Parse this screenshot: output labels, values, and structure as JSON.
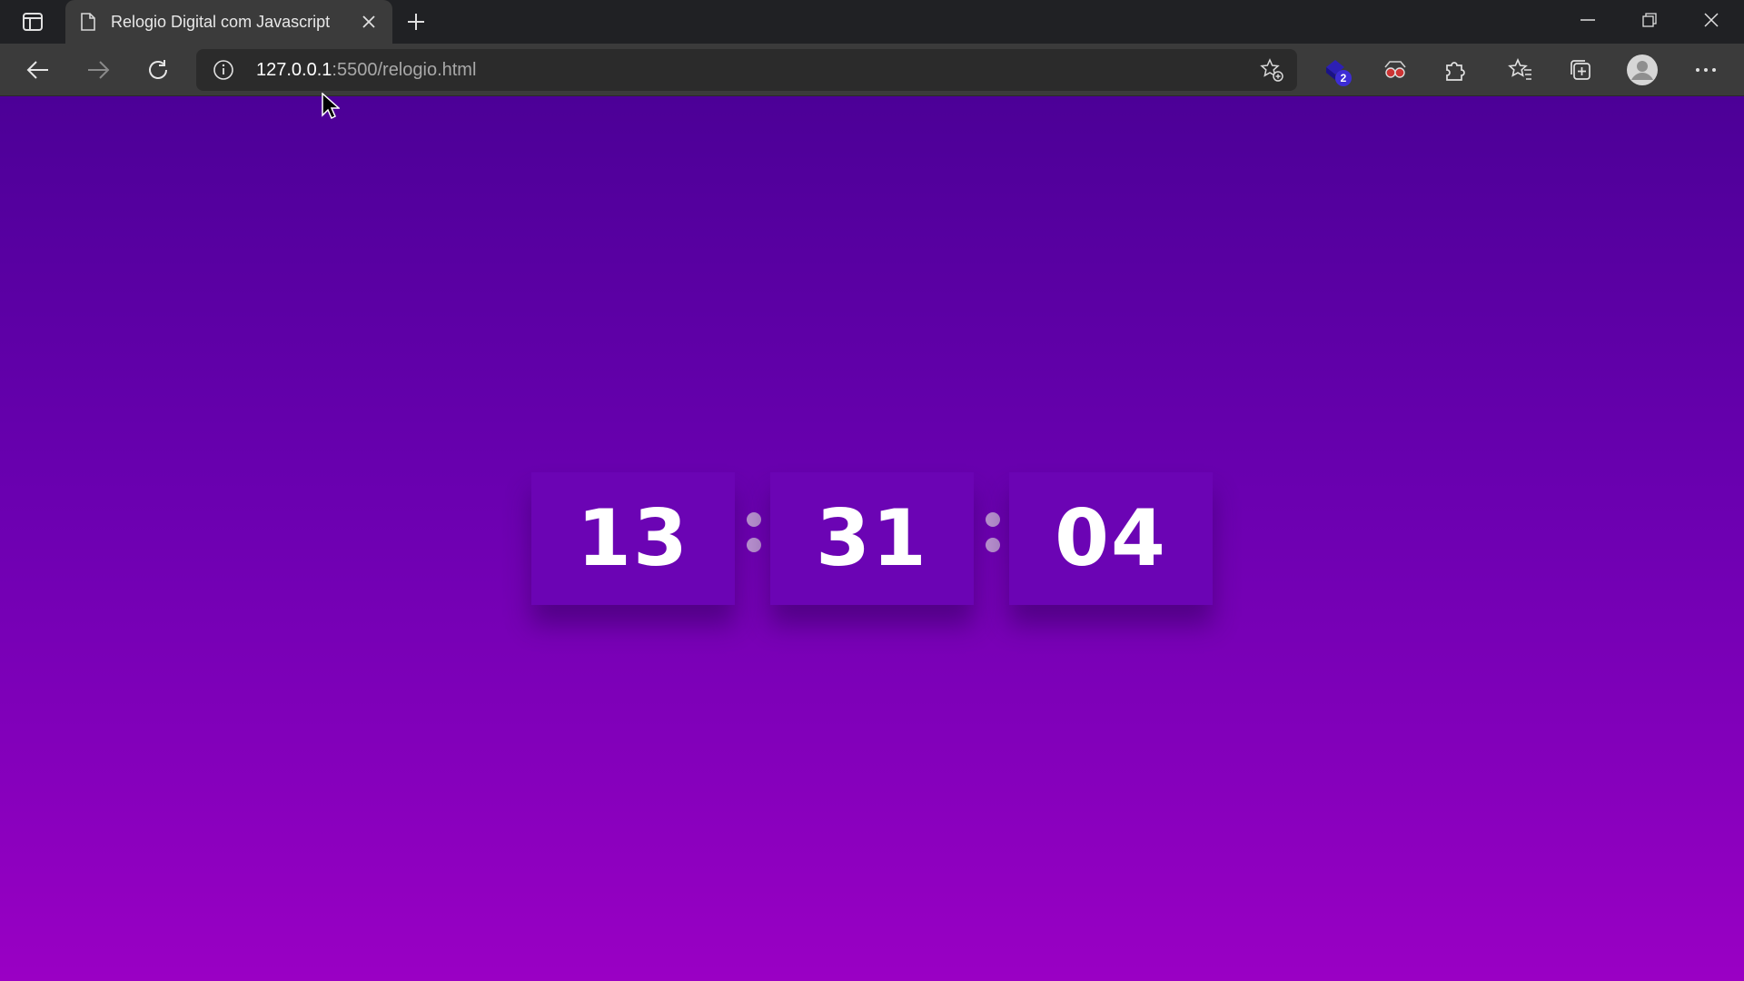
{
  "browser": {
    "tab": {
      "title": "Relogio Digital com Javascript"
    },
    "address_bar": {
      "host": "127.0.0.1",
      "path": ":5500/relogio.html"
    },
    "extension_badge": "2",
    "icons": [
      "tab-actions-icon",
      "page-icon",
      "close-icon",
      "plus-icon",
      "minimize-icon",
      "restore-icon",
      "window-close-icon",
      "back-icon",
      "forward-icon",
      "refresh-icon",
      "info-icon",
      "add-favorite-icon",
      "extension-icon",
      "reader-extension-icon",
      "extensions-puzzle-icon",
      "favorites-icon",
      "collections-icon",
      "profile-icon",
      "more-icon"
    ]
  },
  "clock": {
    "hours": "13",
    "minutes": "31",
    "seconds": "04"
  },
  "colors": {
    "gradient_top": "#4c0097",
    "gradient_bottom": "#9a00c4",
    "digit_box": "#6b04b4",
    "separator_dot": "#b68fcd"
  }
}
